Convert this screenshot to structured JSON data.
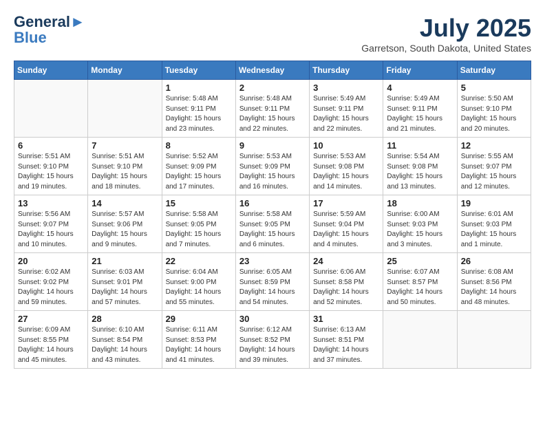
{
  "header": {
    "logo_line1": "General",
    "logo_line2": "Blue",
    "month": "July 2025",
    "location": "Garretson, South Dakota, United States"
  },
  "weekdays": [
    "Sunday",
    "Monday",
    "Tuesday",
    "Wednesday",
    "Thursday",
    "Friday",
    "Saturday"
  ],
  "weeks": [
    [
      {
        "day": "",
        "info": ""
      },
      {
        "day": "",
        "info": ""
      },
      {
        "day": "1",
        "info": "Sunrise: 5:48 AM\nSunset: 9:11 PM\nDaylight: 15 hours and 23 minutes."
      },
      {
        "day": "2",
        "info": "Sunrise: 5:48 AM\nSunset: 9:11 PM\nDaylight: 15 hours and 22 minutes."
      },
      {
        "day": "3",
        "info": "Sunrise: 5:49 AM\nSunset: 9:11 PM\nDaylight: 15 hours and 22 minutes."
      },
      {
        "day": "4",
        "info": "Sunrise: 5:49 AM\nSunset: 9:11 PM\nDaylight: 15 hours and 21 minutes."
      },
      {
        "day": "5",
        "info": "Sunrise: 5:50 AM\nSunset: 9:10 PM\nDaylight: 15 hours and 20 minutes."
      }
    ],
    [
      {
        "day": "6",
        "info": "Sunrise: 5:51 AM\nSunset: 9:10 PM\nDaylight: 15 hours and 19 minutes."
      },
      {
        "day": "7",
        "info": "Sunrise: 5:51 AM\nSunset: 9:10 PM\nDaylight: 15 hours and 18 minutes."
      },
      {
        "day": "8",
        "info": "Sunrise: 5:52 AM\nSunset: 9:09 PM\nDaylight: 15 hours and 17 minutes."
      },
      {
        "day": "9",
        "info": "Sunrise: 5:53 AM\nSunset: 9:09 PM\nDaylight: 15 hours and 16 minutes."
      },
      {
        "day": "10",
        "info": "Sunrise: 5:53 AM\nSunset: 9:08 PM\nDaylight: 15 hours and 14 minutes."
      },
      {
        "day": "11",
        "info": "Sunrise: 5:54 AM\nSunset: 9:08 PM\nDaylight: 15 hours and 13 minutes."
      },
      {
        "day": "12",
        "info": "Sunrise: 5:55 AM\nSunset: 9:07 PM\nDaylight: 15 hours and 12 minutes."
      }
    ],
    [
      {
        "day": "13",
        "info": "Sunrise: 5:56 AM\nSunset: 9:07 PM\nDaylight: 15 hours and 10 minutes."
      },
      {
        "day": "14",
        "info": "Sunrise: 5:57 AM\nSunset: 9:06 PM\nDaylight: 15 hours and 9 minutes."
      },
      {
        "day": "15",
        "info": "Sunrise: 5:58 AM\nSunset: 9:05 PM\nDaylight: 15 hours and 7 minutes."
      },
      {
        "day": "16",
        "info": "Sunrise: 5:58 AM\nSunset: 9:05 PM\nDaylight: 15 hours and 6 minutes."
      },
      {
        "day": "17",
        "info": "Sunrise: 5:59 AM\nSunset: 9:04 PM\nDaylight: 15 hours and 4 minutes."
      },
      {
        "day": "18",
        "info": "Sunrise: 6:00 AM\nSunset: 9:03 PM\nDaylight: 15 hours and 3 minutes."
      },
      {
        "day": "19",
        "info": "Sunrise: 6:01 AM\nSunset: 9:03 PM\nDaylight: 15 hours and 1 minute."
      }
    ],
    [
      {
        "day": "20",
        "info": "Sunrise: 6:02 AM\nSunset: 9:02 PM\nDaylight: 14 hours and 59 minutes."
      },
      {
        "day": "21",
        "info": "Sunrise: 6:03 AM\nSunset: 9:01 PM\nDaylight: 14 hours and 57 minutes."
      },
      {
        "day": "22",
        "info": "Sunrise: 6:04 AM\nSunset: 9:00 PM\nDaylight: 14 hours and 55 minutes."
      },
      {
        "day": "23",
        "info": "Sunrise: 6:05 AM\nSunset: 8:59 PM\nDaylight: 14 hours and 54 minutes."
      },
      {
        "day": "24",
        "info": "Sunrise: 6:06 AM\nSunset: 8:58 PM\nDaylight: 14 hours and 52 minutes."
      },
      {
        "day": "25",
        "info": "Sunrise: 6:07 AM\nSunset: 8:57 PM\nDaylight: 14 hours and 50 minutes."
      },
      {
        "day": "26",
        "info": "Sunrise: 6:08 AM\nSunset: 8:56 PM\nDaylight: 14 hours and 48 minutes."
      }
    ],
    [
      {
        "day": "27",
        "info": "Sunrise: 6:09 AM\nSunset: 8:55 PM\nDaylight: 14 hours and 45 minutes."
      },
      {
        "day": "28",
        "info": "Sunrise: 6:10 AM\nSunset: 8:54 PM\nDaylight: 14 hours and 43 minutes."
      },
      {
        "day": "29",
        "info": "Sunrise: 6:11 AM\nSunset: 8:53 PM\nDaylight: 14 hours and 41 minutes."
      },
      {
        "day": "30",
        "info": "Sunrise: 6:12 AM\nSunset: 8:52 PM\nDaylight: 14 hours and 39 minutes."
      },
      {
        "day": "31",
        "info": "Sunrise: 6:13 AM\nSunset: 8:51 PM\nDaylight: 14 hours and 37 minutes."
      },
      {
        "day": "",
        "info": ""
      },
      {
        "day": "",
        "info": ""
      }
    ]
  ]
}
